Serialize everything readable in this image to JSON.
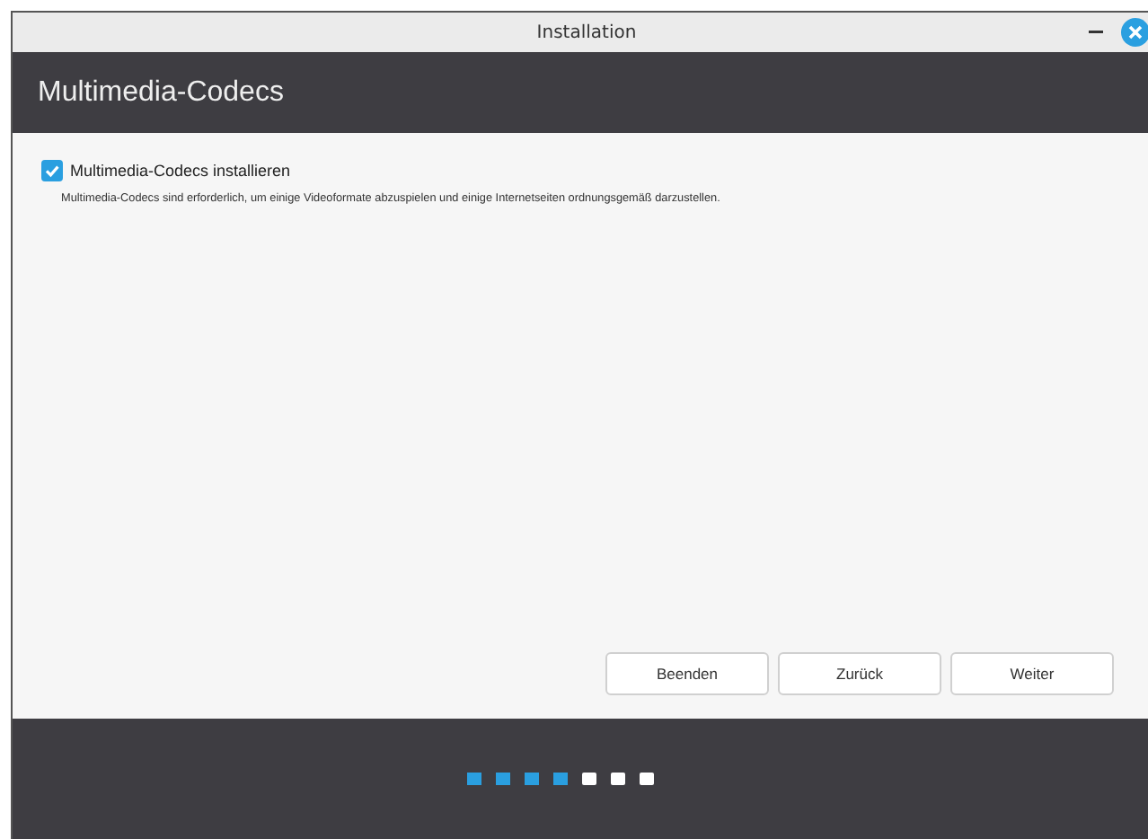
{
  "window": {
    "title": "Installation"
  },
  "header": {
    "title": "Multimedia-Codecs"
  },
  "option": {
    "label": "Multimedia-Codecs installieren",
    "checked": true,
    "description": "Multimedia-Codecs sind erforderlich, um einige Videoformate abzuspielen und einige Internetseiten ordnungsgemäß darzustellen."
  },
  "buttons": [
    "Beenden",
    "Zurück",
    "Weiter"
  ],
  "progress": [
    {
      "done": true
    },
    {
      "done": true
    },
    {
      "done": true
    },
    {
      "done": true
    },
    {
      "done": false
    },
    {
      "done": false
    },
    {
      "done": false
    }
  ]
}
